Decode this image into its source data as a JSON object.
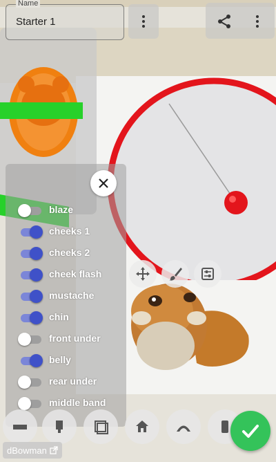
{
  "header": {
    "name_label": "Name",
    "name_value": "Starter 1"
  },
  "pattern_panel": {
    "items": [
      {
        "label": "blaze",
        "on": false
      },
      {
        "label": "cheeks 1",
        "on": true
      },
      {
        "label": "cheeks 2",
        "on": true
      },
      {
        "label": "cheek flash",
        "on": true
      },
      {
        "label": "mustache",
        "on": true
      },
      {
        "label": "chin",
        "on": true
      },
      {
        "label": "front under",
        "on": false
      },
      {
        "label": "belly",
        "on": true
      },
      {
        "label": "rear under",
        "on": false
      },
      {
        "label": "middle band",
        "on": false
      }
    ]
  },
  "footer": {
    "author": "dBowman"
  },
  "colors": {
    "toggle_on_knob": "#3f51c8",
    "toggle_on_track": "#7b86d8",
    "confirm": "#34c35a",
    "wheel": "#e3151c",
    "accent_green": "#27d12a"
  }
}
